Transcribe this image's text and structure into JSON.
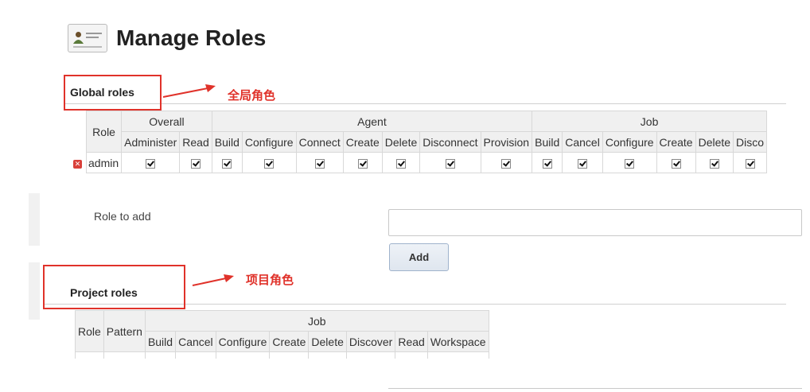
{
  "page": {
    "title": "Manage Roles",
    "icon": "id-card-icon"
  },
  "global_roles": {
    "title": "Global roles",
    "annotation": "全局角色",
    "role_header": "Role",
    "groups": [
      {
        "name": "Overall",
        "columns": [
          "Administer",
          "Read"
        ]
      },
      {
        "name": "Agent",
        "columns": [
          "Build",
          "Configure",
          "Connect",
          "Create",
          "Delete",
          "Disconnect",
          "Provision"
        ]
      },
      {
        "name": "Job",
        "columns": [
          "Build",
          "Cancel",
          "Configure",
          "Create",
          "Delete",
          "Disco"
        ]
      }
    ],
    "rows": [
      {
        "role": "admin",
        "checked": [
          true,
          true,
          true,
          true,
          true,
          true,
          true,
          true,
          true,
          true,
          true,
          true,
          true,
          true,
          true
        ]
      }
    ]
  },
  "role_to_add": {
    "label": "Role to add",
    "value": "",
    "button": "Add"
  },
  "project_roles": {
    "title": "Project roles",
    "annotation": "项目角色",
    "role_header": "Role",
    "pattern_header": "Pattern",
    "group": "Job",
    "columns": [
      "Build",
      "Cancel",
      "Configure",
      "Create",
      "Delete",
      "Discover",
      "Read",
      "Workspace"
    ]
  },
  "colors": {
    "annotation_red": "#e0322a",
    "header_bg": "#f0f0f0"
  }
}
